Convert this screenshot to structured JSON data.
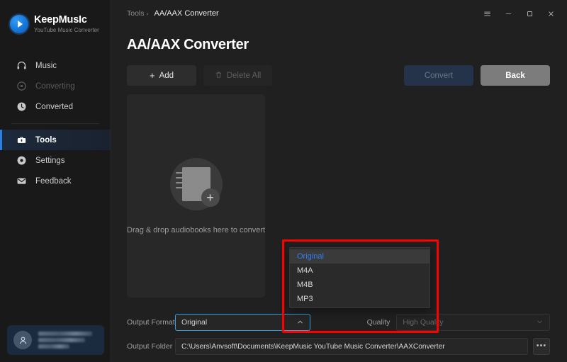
{
  "brand": {
    "name": "KeepMusIc",
    "tagline": "YouTube Music Converter",
    "logo_icon": "play-circle-icon"
  },
  "sidebar": {
    "items": [
      {
        "label": "Music",
        "icon": "headphones-icon",
        "state": "normal"
      },
      {
        "label": "Converting",
        "icon": "refresh-circle-icon",
        "state": "disabled"
      },
      {
        "label": "Converted",
        "icon": "clock-icon",
        "state": "normal"
      },
      {
        "label": "Tools",
        "icon": "toolbox-icon",
        "state": "active"
      },
      {
        "label": "Settings",
        "icon": "gear-icon",
        "state": "normal"
      },
      {
        "label": "Feedback",
        "icon": "envelope-icon",
        "state": "normal"
      }
    ],
    "account": {
      "avatar_icon": "user-avatar-icon",
      "name_redacted": true
    }
  },
  "titlebar": {
    "breadcrumb_parent": "Tools",
    "breadcrumb_separator": "›",
    "breadcrumb_current": "AA/AAX Converter",
    "controls": [
      {
        "name": "menu-icon",
        "glyph": "☰"
      },
      {
        "name": "minimize-icon",
        "glyph": "–"
      },
      {
        "name": "maximize-icon",
        "glyph": "□"
      },
      {
        "name": "close-icon",
        "glyph": "✕"
      }
    ]
  },
  "page": {
    "title": "AA/AAX Converter"
  },
  "toolbar": {
    "add_label": "Add",
    "add_icon": "plus-icon",
    "delete_all_label": "Delete All",
    "delete_all_icon": "trash-icon",
    "convert_label": "Convert",
    "back_label": "Back"
  },
  "dropzone": {
    "icon": "add-document-icon",
    "text": "Drag & drop audiobooks here to convert"
  },
  "form": {
    "output_format_label": "Output Format",
    "output_format_value": "Original",
    "output_format_caret": "⌃",
    "quality_label": "Quality",
    "quality_value": "High Quality",
    "quality_caret": "⌵",
    "output_folder_label": "Output Folder",
    "output_folder_value": "C:\\Users\\Anvsoft\\Documents\\KeepMusic YouTube Music Converter\\AAXConverter",
    "browse_label": "•••"
  },
  "format_dropdown": {
    "open": true,
    "options": [
      {
        "label": "Original",
        "selected": true
      },
      {
        "label": "M4A",
        "selected": false
      },
      {
        "label": "M4B",
        "selected": false
      },
      {
        "label": "MP3",
        "selected": false
      }
    ]
  },
  "colors": {
    "accent_blue": "#2b7fe0",
    "selected_option": "#2f7ff5",
    "focus_border": "#2f9fe0",
    "callout_red": "#ff0000",
    "background": "#202020",
    "sidebar_bg": "#191919",
    "panel_bg": "#282828"
  }
}
